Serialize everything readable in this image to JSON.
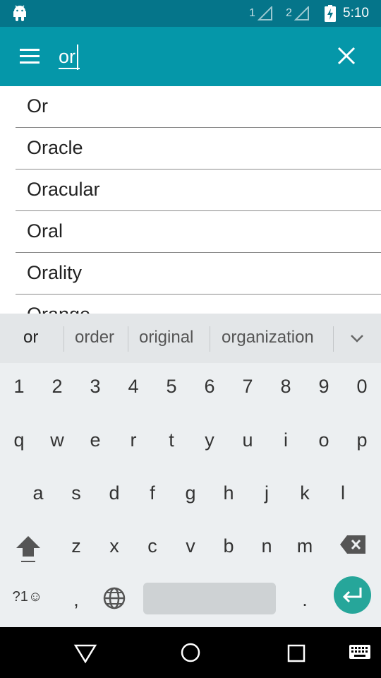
{
  "status_bar": {
    "time": "5:10",
    "sim1_label": "1",
    "sim2_label": "2",
    "notification_icon": "android-icon",
    "battery_icon": "battery-charging-icon"
  },
  "app_bar": {
    "menu_icon": "menu-icon",
    "search_value": "or",
    "close_icon": "close-icon",
    "color": "#0597a9"
  },
  "suggestions": [
    "Or",
    "Oracle",
    "Oracular",
    "Oral",
    "Orality",
    "Orange"
  ],
  "keyboard": {
    "suggestion_strip": [
      "or",
      "order",
      "original",
      "organization"
    ],
    "number_row": [
      "1",
      "2",
      "3",
      "4",
      "5",
      "6",
      "7",
      "8",
      "9",
      "0"
    ],
    "row1": [
      "q",
      "w",
      "e",
      "r",
      "t",
      "y",
      "u",
      "i",
      "o",
      "p"
    ],
    "row2": [
      "a",
      "s",
      "d",
      "f",
      "g",
      "h",
      "j",
      "k",
      "l"
    ],
    "row3": [
      "z",
      "x",
      "c",
      "v",
      "b",
      "n",
      "m"
    ],
    "symbols_label": "?1☺",
    "comma_label": ",",
    "period_label": ".",
    "enter_color": "#26a69a"
  },
  "nav_bar": {
    "back_icon": "back-icon",
    "home_icon": "home-icon",
    "recents_icon": "recents-icon",
    "keyboard_icon": "keyboard-icon"
  }
}
